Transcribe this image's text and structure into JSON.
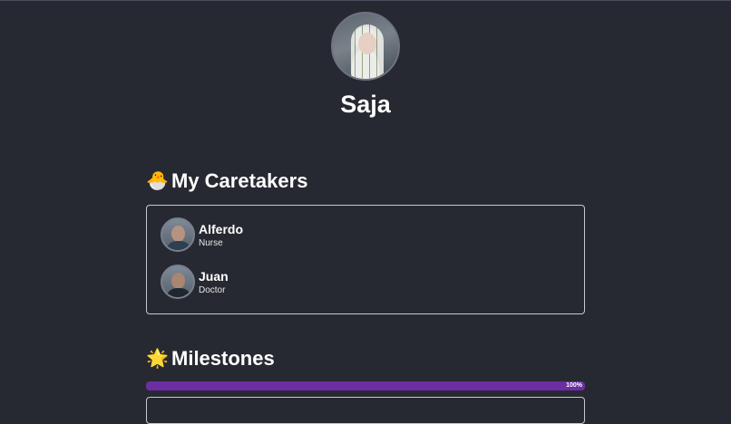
{
  "profile": {
    "name": "Saja"
  },
  "caretakers": {
    "emoji": "🐣",
    "title": "My Caretakers",
    "items": [
      {
        "name": "Alferdo",
        "role": "Nurse"
      },
      {
        "name": "Juan",
        "role": "Doctor"
      }
    ]
  },
  "milestones": {
    "emoji": "🌟",
    "title": "Milestones",
    "progress_label": "100%",
    "progress_fraction": 1.0,
    "progress_color": "#6d2ea4"
  },
  "colors": {
    "background": "#272932",
    "border": "#c7c9cf"
  }
}
